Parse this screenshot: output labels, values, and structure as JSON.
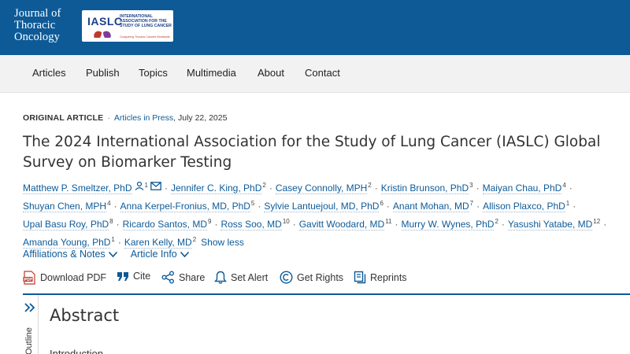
{
  "header": {
    "journal_line1": "Journal of",
    "journal_line2": "Thoracic",
    "journal_line3": "Oncology",
    "partner_abbr": "IASLC",
    "partner_name": "INTERNATIONAL ASSOCIATION FOR THE STUDY OF LUNG CANCER",
    "partner_tagline": "Conquering Thoracic Cancers Worldwide",
    "bar_color": "#0d5a97"
  },
  "nav": {
    "items": [
      "Articles",
      "Publish",
      "Topics",
      "Multimedia",
      "About",
      "Contact"
    ]
  },
  "article": {
    "type_label": "ORIGINAL ARTICLE",
    "status": "Articles in Press",
    "date": ", July 22, 2025",
    "title": "The 2024 International Association for the Study of Lung Cancer (IASLC) Global Survey on Biomarker Testing",
    "authors": [
      {
        "name": "Matthew P. Smeltzer, PhD",
        "aff": "1"
      },
      {
        "name": "Jennifer C. King, PhD",
        "aff": "2"
      },
      {
        "name": "Casey Connolly, MPH",
        "aff": "2"
      },
      {
        "name": "Kristin Brunson, PhD",
        "aff": "3"
      },
      {
        "name": "Maiyan Chau, PhD",
        "aff": "4"
      },
      {
        "name": "Shuyan Chen, MPH",
        "aff": "4"
      },
      {
        "name": "Anna Kerpel-Fronius, MD, PhD",
        "aff": "5"
      },
      {
        "name": "Sylvie Lantuejoul, MD, PhD",
        "aff": "6"
      },
      {
        "name": "Anant Mohan, MD",
        "aff": "7"
      },
      {
        "name": "Allison Plaxco, PhD",
        "aff": "1"
      },
      {
        "name": "Upal Basu Roy, PhD",
        "aff": "8"
      },
      {
        "name": "Ricardo Santos, MD",
        "aff": "9"
      },
      {
        "name": "Ross Soo, MD",
        "aff": "10"
      },
      {
        "name": "Gavitt Woodard, MD",
        "aff": "11"
      },
      {
        "name": "Murry W. Wynes, PhD",
        "aff": "2"
      },
      {
        "name": "Yasushi Yatabe, MD",
        "aff": "12"
      },
      {
        "name": "Amanda Young, PhD",
        "aff": "1"
      },
      {
        "name": "Karen Kelly, MD",
        "aff": "2"
      }
    ],
    "show_less": "Show less",
    "affiliations_label": "Affiliations & Notes",
    "article_info_label": "Article Info"
  },
  "tools": {
    "download_pdf": "Download PDF",
    "cite": "Cite",
    "share": "Share",
    "set_alert": "Set Alert",
    "get_rights": "Get Rights",
    "reprints": "Reprints"
  },
  "outline": {
    "label": "Outline"
  },
  "abstract": {
    "heading": "Abstract",
    "first_section": "Introduction"
  }
}
